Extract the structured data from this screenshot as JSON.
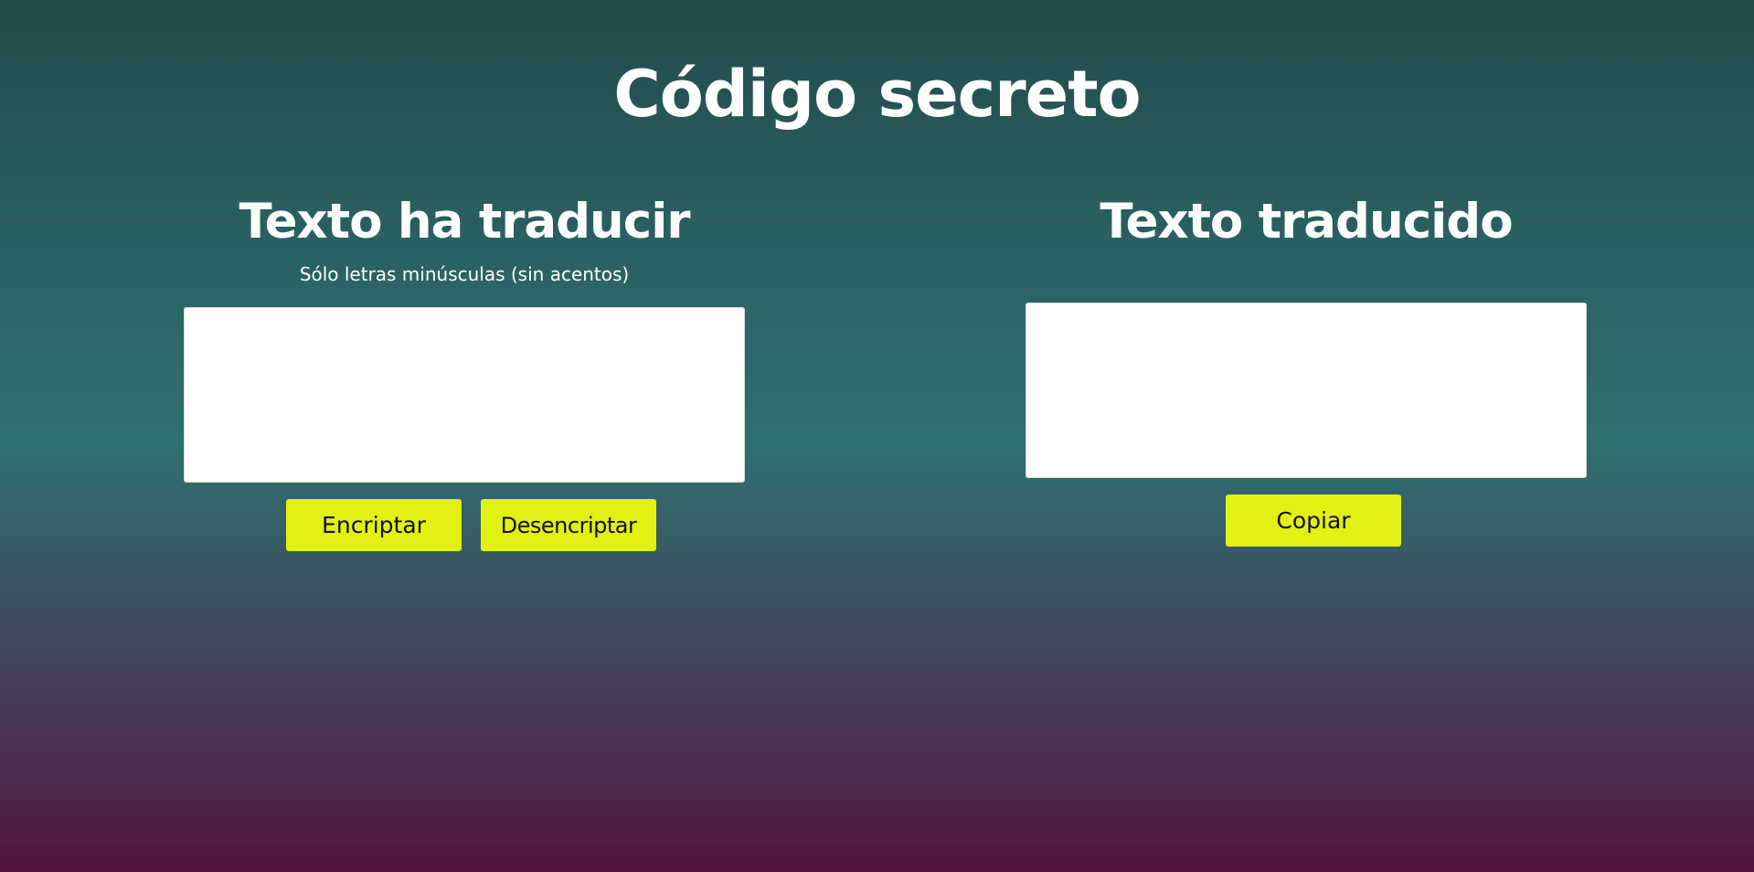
{
  "page": {
    "title": "Código secreto"
  },
  "input_panel": {
    "heading": "Texto ha traducir",
    "hint": "Sólo letras minúsculas (sin acentos)",
    "textarea_value": "",
    "encrypt_label": "Encriptar",
    "decrypt_label": "Desencriptar"
  },
  "output_panel": {
    "heading": "Texto traducido",
    "textarea_value": "",
    "copy_label": "Copiar"
  },
  "colors": {
    "accent_button": "#e1f111",
    "gradient_top": "#224b4b",
    "gradient_middle": "#2e7070",
    "gradient_bottom": "#52153b",
    "text": "#ffffff"
  }
}
